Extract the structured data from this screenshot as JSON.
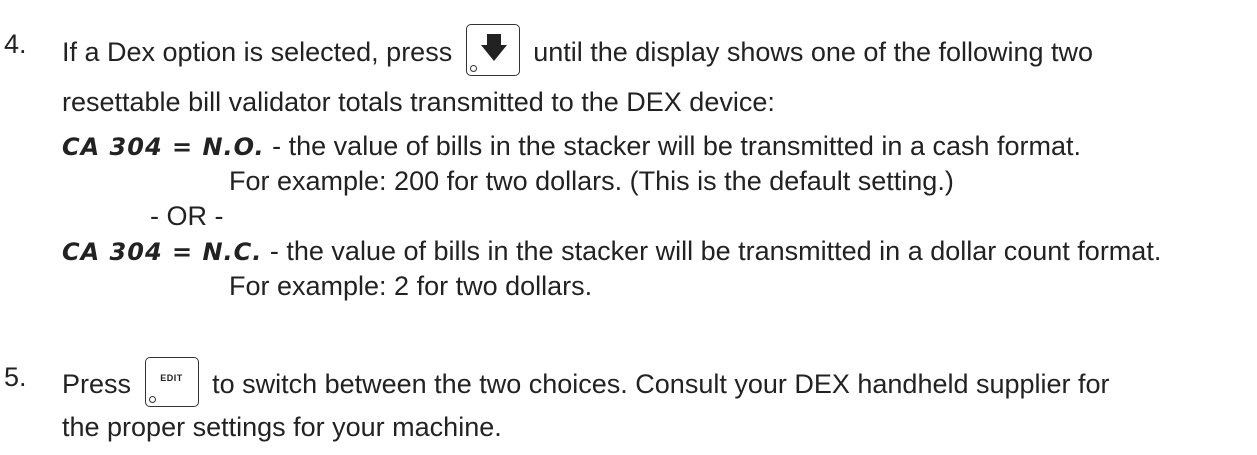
{
  "step4": {
    "number": "4.",
    "text_before": "If a Dex option is selected, press",
    "text_after": "until the display shows one of the following two",
    "line2": "resettable bill validator totals transmitted to the DEX device:",
    "option_a": {
      "code": "CA 304 = N.O.",
      "desc": " - the value of bills in the stacker will be transmitted in a cash format.",
      "example": "For example: 200 for two dollars. (This is the default setting.)"
    },
    "or_text": "- OR -",
    "option_b": {
      "code": "CA 304 = N.C.",
      "desc": " - the value of bills in the stacker will be transmitted in a dollar count format.",
      "example": "For example: 2 for two dollars."
    }
  },
  "step5": {
    "number": "5.",
    "text_before": "Press",
    "key_label": "EDIT",
    "text_after": "to switch between the two choices. Consult your DEX handheld supplier for",
    "line2": "the proper settings for your machine."
  },
  "icons": {
    "down_key": "down-arrow-key-icon",
    "edit_key": "edit-key-icon"
  }
}
